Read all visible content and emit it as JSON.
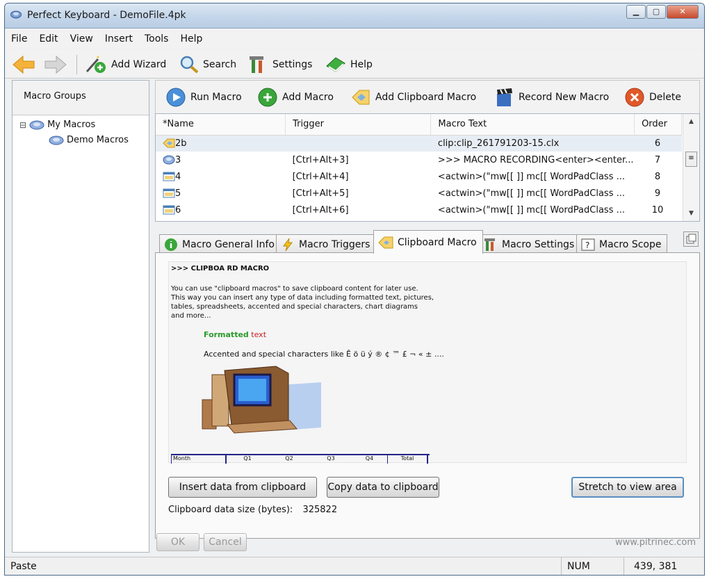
{
  "window": {
    "title": "Perfect Keyboard - DemoFile.4pk"
  },
  "menu": [
    "File",
    "Edit",
    "View",
    "Insert",
    "Tools",
    "Help"
  ],
  "toolbar": {
    "add_wizard": "Add Wizard",
    "search": "Search",
    "settings": "Settings",
    "help": "Help"
  },
  "left": {
    "header": "Macro Groups",
    "tree": [
      {
        "label": "My Macros",
        "expander": "⊟"
      },
      {
        "label": "Demo Macros"
      }
    ]
  },
  "actions": {
    "run": "Run Macro",
    "add": "Add Macro",
    "add_clipboard": "Add Clipboard Macro",
    "record": "Record New Macro",
    "delete": "Delete"
  },
  "grid": {
    "columns": [
      "*Name",
      "Trigger",
      "Macro Text",
      "Order"
    ],
    "rows": [
      {
        "name": "2b",
        "trigger": "",
        "text": "clip:clip_261791203-15.clx",
        "order": "6"
      },
      {
        "name": "3",
        "trigger": "[Ctrl+Alt+3]",
        "text": ">>> MACRO RECORDING<enter><enter...",
        "order": "7"
      },
      {
        "name": "4",
        "trigger": "[Ctrl+Alt+4]",
        "text": "<actwin>(\"mw[[  ]] mc[[ WordPadClass ...",
        "order": "8"
      },
      {
        "name": "5",
        "trigger": "[Ctrl+Alt+5]",
        "text": "<actwin>(\"mw[[  ]] mc[[ WordPadClass ...",
        "order": "9"
      },
      {
        "name": "6",
        "trigger": "[Ctrl+Alt+6]",
        "text": "<actwin>(\"mw[[  ]] mc[[ WordPadClass ...",
        "order": "10"
      }
    ]
  },
  "tabs": [
    "Macro General Info",
    "Macro Triggers",
    "Clipboard Macro",
    "Macro Settings",
    "Macro Scope"
  ],
  "clipboard": {
    "heading": ">>> CLIPBOA RD MACRO",
    "para1": "You can use \"clipboard macros\" to save clipboard content for later use.",
    "para2": "This way you can insert any type of data including formatted text, pictures,",
    "para3": "tables, spreadsheets, accented and special characters, chart diagrams",
    "para4": "and more...",
    "formatted_green": "Formatted",
    "formatted_red": "text",
    "accented": "Accented and special characters like Ê ö ü ý ® ¢ ™ £ ¬ « ± ....",
    "table_headers": [
      "Month",
      "Q1",
      "Q2",
      "Q3",
      "Q4",
      "Total"
    ],
    "insert_btn": "Insert data from clipboard",
    "copy_btn": "Copy data to clipboard",
    "stretch_btn": "Stretch to view area",
    "size_label": "Clipboard data size (bytes):",
    "size_value": "325822"
  },
  "footer": {
    "ok": "OK",
    "cancel": "Cancel",
    "site": "www.pitrinec.com"
  },
  "status": {
    "text": "Paste",
    "num": "NUM",
    "coords": "439, 381"
  }
}
